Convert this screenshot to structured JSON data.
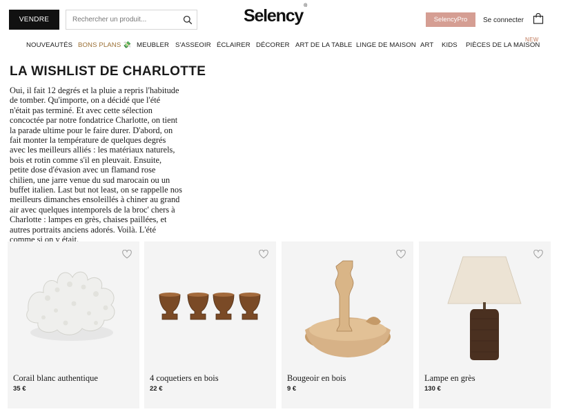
{
  "header": {
    "sell_label": "VENDRE",
    "search_placeholder": "Rechercher un produit...",
    "logo_text": "Selency",
    "logo_mark": "®",
    "pro_label": "SelencyPro",
    "login_label": "Se connecter"
  },
  "nav": {
    "items": [
      {
        "label": "NOUVEAUTÉS"
      },
      {
        "label": "BONS PLANS 💸"
      },
      {
        "label": "MEUBLER"
      },
      {
        "label": "S'ASSEOIR"
      },
      {
        "label": "ÉCLAIRER"
      },
      {
        "label": "DÉCORER"
      },
      {
        "label": "ART DE LA TABLE"
      },
      {
        "label": "LINGE DE MAISON"
      },
      {
        "label": "ART"
      },
      {
        "label": "KIDS"
      },
      {
        "label": "PIÈCES DE LA MAISON"
      }
    ],
    "new_badge": "NEW"
  },
  "main": {
    "title": "LA WISHLIST DE CHARLOTTE",
    "intro": "Oui, il fait 12 degrés et la pluie a repris l'habitude de tomber. Qu'importe, on a décidé que l'été n'était pas terminé. Et avec cette sélection concoctée par notre fondatrice Charlotte, on tient la parade ultime pour le faire durer. D'abord, on fait monter la température de quelques degrés avec les meilleurs alliés : les matériaux naturels, bois et rotin comme s'il en pleuvait. Ensuite, petite dose d'évasion avec un flamand rose chilien, une jarre venue du sud marocain ou un buffet italien. Last but not least, on se rappelle nos meilleurs dimanches ensoleillés à chiner au grand air avec quelques intemporels de la broc' chers à Charlotte : lampes en grès, chaises paillées, et autres portraits anciens adorés. Voilà. L'été comme si on y était."
  },
  "products": [
    {
      "name": "Corail blanc authentique",
      "price": "35 €"
    },
    {
      "name": "4 coquetiers en bois",
      "price": "22 €"
    },
    {
      "name": "Bougeoir en bois",
      "price": "9 €"
    },
    {
      "name": "Lampe en grès",
      "price": "130 €"
    }
  ],
  "colors": {
    "accent": "#d59e93",
    "highlight": "#9a6f34",
    "card_bg": "#f4f4f4"
  }
}
